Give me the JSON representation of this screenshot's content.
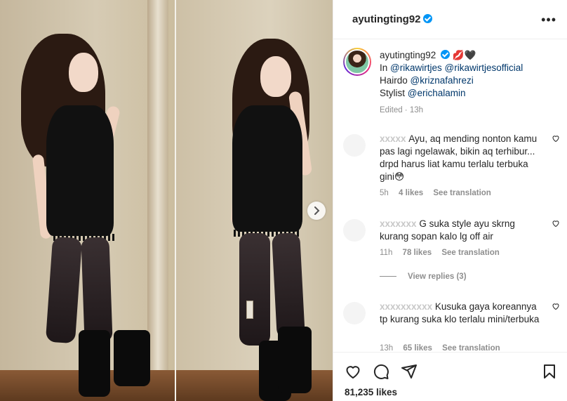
{
  "post": {
    "username": "ayutingting92",
    "caption": {
      "line1_emoji": "💋🖤",
      "line2_prefix": "In",
      "mention1": "@rikawirtjes",
      "mention2": "@rikawirtjesofficial",
      "line3_prefix": "Hairdo",
      "mention3": "@kriznafahrezi",
      "line4_prefix": "Stylist",
      "mention4": "@erichalamin",
      "edited": "Edited · 13h"
    },
    "likes": "81,235 likes"
  },
  "comments": [
    {
      "text": "Ayu, aq mending nonton kamu pas lagi ngelawak, bikin aq terhibur... drpd harus liat kamu terlalu terbuka gini😳",
      "time": "5h",
      "likes": "4 likes",
      "translate": "See translation"
    },
    {
      "text": "G suka style ayu skrng kurang sopan kalo lg off air",
      "time": "11h",
      "likes": "78 likes",
      "translate": "See translation"
    },
    {
      "text": "Kusuka gaya koreannya tp kurang suka klo terlalu mini/terbuka",
      "time": "13h",
      "likes": "65 likes",
      "translate": "See translation"
    }
  ],
  "view_replies": "View replies (3)",
  "icons": {
    "more": "more-options-icon",
    "verified": "verified-badge-icon",
    "heart": "heart-icon",
    "comment": "comment-icon",
    "share": "share-icon",
    "save": "bookmark-icon",
    "next": "chevron-right-icon"
  },
  "colors": {
    "mention": "#00376b",
    "verified": "#0095f6",
    "meta": "#8e8e8e"
  }
}
